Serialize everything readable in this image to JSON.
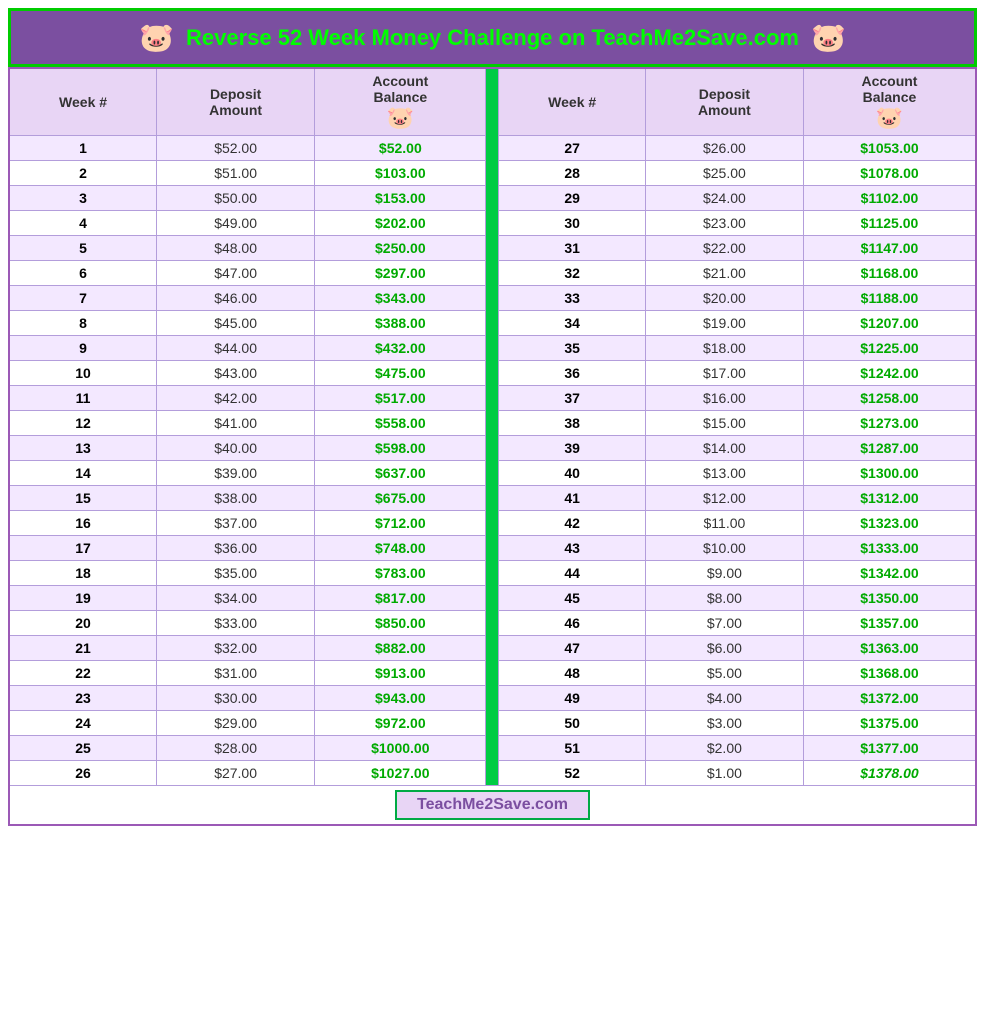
{
  "header": {
    "title": "Reverse 52 Week Money Challenge on TeachMe2Save.com",
    "pig_icon": "🐷"
  },
  "columns": {
    "left": {
      "week": "Week #",
      "deposit": "Deposit Amount",
      "balance": "Account Balance"
    },
    "right": {
      "week": "Week #",
      "deposit": "Deposit Amount",
      "balance": "Account Balance"
    }
  },
  "footer": {
    "url": "TeachMe2Save.com"
  },
  "rows_left": [
    {
      "week": 1,
      "deposit": "$52.00",
      "balance": "$52.00"
    },
    {
      "week": 2,
      "deposit": "$51.00",
      "balance": "$103.00"
    },
    {
      "week": 3,
      "deposit": "$50.00",
      "balance": "$153.00"
    },
    {
      "week": 4,
      "deposit": "$49.00",
      "balance": "$202.00"
    },
    {
      "week": 5,
      "deposit": "$48.00",
      "balance": "$250.00"
    },
    {
      "week": 6,
      "deposit": "$47.00",
      "balance": "$297.00"
    },
    {
      "week": 7,
      "deposit": "$46.00",
      "balance": "$343.00"
    },
    {
      "week": 8,
      "deposit": "$45.00",
      "balance": "$388.00"
    },
    {
      "week": 9,
      "deposit": "$44.00",
      "balance": "$432.00"
    },
    {
      "week": 10,
      "deposit": "$43.00",
      "balance": "$475.00"
    },
    {
      "week": 11,
      "deposit": "$42.00",
      "balance": "$517.00"
    },
    {
      "week": 12,
      "deposit": "$41.00",
      "balance": "$558.00"
    },
    {
      "week": 13,
      "deposit": "$40.00",
      "balance": "$598.00"
    },
    {
      "week": 14,
      "deposit": "$39.00",
      "balance": "$637.00"
    },
    {
      "week": 15,
      "deposit": "$38.00",
      "balance": "$675.00"
    },
    {
      "week": 16,
      "deposit": "$37.00",
      "balance": "$712.00"
    },
    {
      "week": 17,
      "deposit": "$36.00",
      "balance": "$748.00"
    },
    {
      "week": 18,
      "deposit": "$35.00",
      "balance": "$783.00"
    },
    {
      "week": 19,
      "deposit": "$34.00",
      "balance": "$817.00"
    },
    {
      "week": 20,
      "deposit": "$33.00",
      "balance": "$850.00"
    },
    {
      "week": 21,
      "deposit": "$32.00",
      "balance": "$882.00"
    },
    {
      "week": 22,
      "deposit": "$31.00",
      "balance": "$913.00"
    },
    {
      "week": 23,
      "deposit": "$30.00",
      "balance": "$943.00"
    },
    {
      "week": 24,
      "deposit": "$29.00",
      "balance": "$972.00"
    },
    {
      "week": 25,
      "deposit": "$28.00",
      "balance": "$1000.00"
    },
    {
      "week": 26,
      "deposit": "$27.00",
      "balance": "$1027.00"
    }
  ],
  "rows_right": [
    {
      "week": 27,
      "deposit": "$26.00",
      "balance": "$1053.00"
    },
    {
      "week": 28,
      "deposit": "$25.00",
      "balance": "$1078.00"
    },
    {
      "week": 29,
      "deposit": "$24.00",
      "balance": "$1102.00"
    },
    {
      "week": 30,
      "deposit": "$23.00",
      "balance": "$1125.00"
    },
    {
      "week": 31,
      "deposit": "$22.00",
      "balance": "$1147.00"
    },
    {
      "week": 32,
      "deposit": "$21.00",
      "balance": "$1168.00"
    },
    {
      "week": 33,
      "deposit": "$20.00",
      "balance": "$1188.00"
    },
    {
      "week": 34,
      "deposit": "$19.00",
      "balance": "$1207.00"
    },
    {
      "week": 35,
      "deposit": "$18.00",
      "balance": "$1225.00"
    },
    {
      "week": 36,
      "deposit": "$17.00",
      "balance": "$1242.00"
    },
    {
      "week": 37,
      "deposit": "$16.00",
      "balance": "$1258.00"
    },
    {
      "week": 38,
      "deposit": "$15.00",
      "balance": "$1273.00"
    },
    {
      "week": 39,
      "deposit": "$14.00",
      "balance": "$1287.00"
    },
    {
      "week": 40,
      "deposit": "$13.00",
      "balance": "$1300.00"
    },
    {
      "week": 41,
      "deposit": "$12.00",
      "balance": "$1312.00"
    },
    {
      "week": 42,
      "deposit": "$11.00",
      "balance": "$1323.00"
    },
    {
      "week": 43,
      "deposit": "$10.00",
      "balance": "$1333.00"
    },
    {
      "week": 44,
      "deposit": "$9.00",
      "balance": "$1342.00"
    },
    {
      "week": 45,
      "deposit": "$8.00",
      "balance": "$1350.00"
    },
    {
      "week": 46,
      "deposit": "$7.00",
      "balance": "$1357.00"
    },
    {
      "week": 47,
      "deposit": "$6.00",
      "balance": "$1363.00"
    },
    {
      "week": 48,
      "deposit": "$5.00",
      "balance": "$1368.00"
    },
    {
      "week": 49,
      "deposit": "$4.00",
      "balance": "$1372.00"
    },
    {
      "week": 50,
      "deposit": "$3.00",
      "balance": "$1375.00"
    },
    {
      "week": 51,
      "deposit": "$2.00",
      "balance": "$1377.00"
    },
    {
      "week": 52,
      "deposit": "$1.00",
      "balance": "$1378.00"
    }
  ]
}
